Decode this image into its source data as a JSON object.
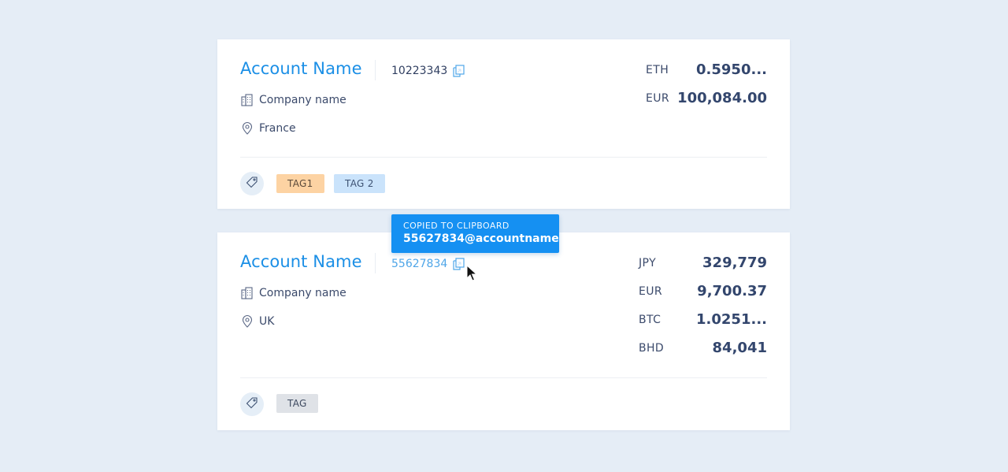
{
  "colors": {
    "background": "#e5edf6",
    "card": "#ffffff",
    "accent": "#1b8fe6",
    "tooltip": "#1590f2",
    "text": "#3b4a6b",
    "tag_orange": "#fdd3a3",
    "tag_blue": "#cae3fb",
    "tag_grey": "#dfe2e7"
  },
  "accounts": [
    {
      "name": "Account Name",
      "number": "10223343",
      "company": "Company name",
      "location": "France",
      "tags": [
        "TAG1",
        "TAG 2"
      ],
      "balances": [
        {
          "currency": "ETH",
          "amount": "0.5950..."
        },
        {
          "currency": "EUR",
          "amount": "100,084.00"
        }
      ]
    },
    {
      "name": "Account Name",
      "number": "55627834",
      "company": "Company name",
      "location": "UK",
      "tags": [
        "TAG"
      ],
      "balances": [
        {
          "currency": "JPY",
          "amount": "329,779"
        },
        {
          "currency": "EUR",
          "amount": "9,700.37"
        },
        {
          "currency": "BTC",
          "amount": "1.0251..."
        },
        {
          "currency": "BHD",
          "amount": "84,041"
        }
      ]
    }
  ],
  "tooltip": {
    "label": "COPIED TO CLIPBOARD",
    "value": "55627834@accountname"
  },
  "icons": {
    "copy": "copy-icon",
    "company": "building-icon",
    "location": "map-pin-icon",
    "tag": "tag-icon",
    "cursor": "mouse-cursor-icon"
  }
}
